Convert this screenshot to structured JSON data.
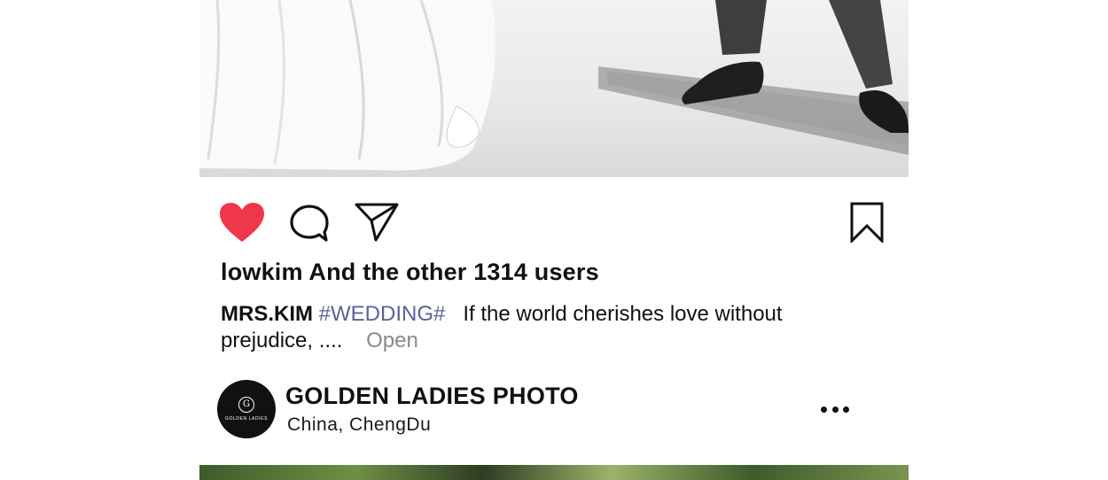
{
  "post": {
    "likes_text": "lowkim And the other 1314 users",
    "caption": {
      "author": "MRS.KIM",
      "hashtag": "#WEDDING#",
      "text": "If the world cherishes love without prejudice, ....",
      "open_label": "Open"
    },
    "actions": {
      "like_icon": "heart-icon",
      "comment_icon": "comment-icon",
      "share_icon": "send-icon",
      "bookmark_icon": "bookmark-icon",
      "like_color": "#f0364a"
    }
  },
  "next_post": {
    "account_name": "GOLDEN LADIES PHOTO",
    "location": "China,  ChengDu",
    "avatar_logo_text": "GOLDEN LADIES",
    "more_icon": "more-dots-icon"
  }
}
